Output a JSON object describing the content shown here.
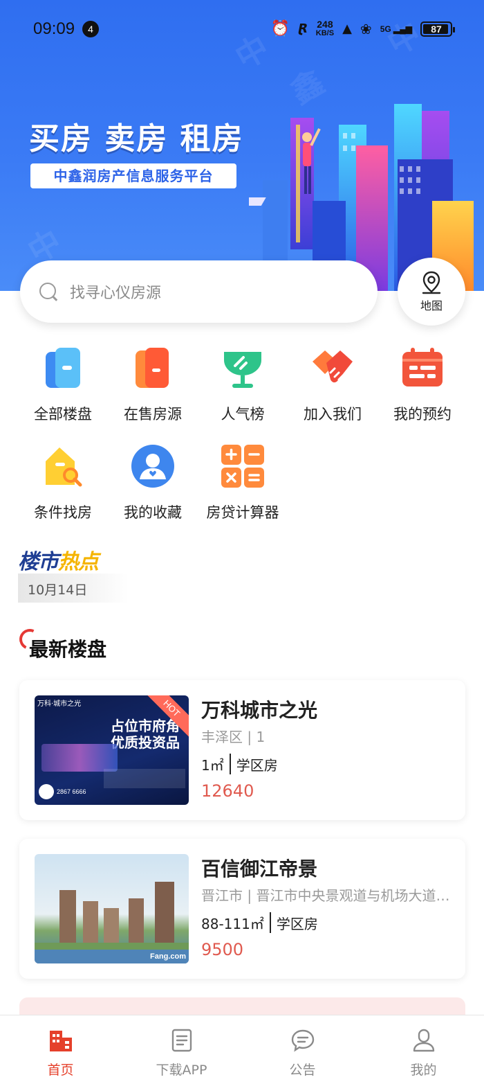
{
  "status_bar": {
    "time": "09:09",
    "notification_count": "4",
    "net_speed_value": "248",
    "net_speed_unit": "KB/S",
    "network": "5G",
    "battery": "87"
  },
  "banner": {
    "slogan": "买房 卖房 租房",
    "subtitle": "中鑫润房产信息服务平台"
  },
  "search": {
    "placeholder": "找寻心仪房源",
    "map_label": "地图"
  },
  "menu": [
    {
      "label": "全部楼盘",
      "icon": "building-icon"
    },
    {
      "label": "在售房源",
      "icon": "door-icon"
    },
    {
      "label": "人气榜",
      "icon": "trophy-icon"
    },
    {
      "label": "加入我们",
      "icon": "handshake-icon"
    },
    {
      "label": "我的预约",
      "icon": "calendar-icon"
    },
    {
      "label": "条件找房",
      "icon": "house-search-icon"
    },
    {
      "label": "我的收藏",
      "icon": "user-heart-icon"
    },
    {
      "label": "房贷计算器",
      "icon": "calculator-icon"
    }
  ],
  "hot_news": {
    "title_a": "楼市",
    "title_b": "热点",
    "date": "10月14日"
  },
  "latest": {
    "title": "最新楼盘",
    "listings": [
      {
        "name": "万科城市之光",
        "location": "丰泽区 | 1",
        "area": "1㎡",
        "tag": "学区房",
        "price": "12640",
        "thumb_brand": "万科·城市之光",
        "thumb_headline_1": "占位市府角",
        "thumb_headline_2": "优质投资品",
        "thumb_phone": "2867 6666",
        "hot_badge": "HOT"
      },
      {
        "name": "百信御江帝景",
        "location": "晋江市 | 晋江市中央景观道与机场大道交汇处",
        "area": "88-111㎡",
        "tag": "学区房",
        "price": "9500",
        "thumb_watermark": "Fang.com"
      }
    ]
  },
  "tabbar": [
    {
      "label": "首页",
      "active": true
    },
    {
      "label": "下载APP",
      "active": false
    },
    {
      "label": "公告",
      "active": false
    },
    {
      "label": "我的",
      "active": false
    }
  ],
  "colors": {
    "brand_blue": "#2f6ef0",
    "accent_red": "#e5402b",
    "price_red": "#e05a4f"
  }
}
